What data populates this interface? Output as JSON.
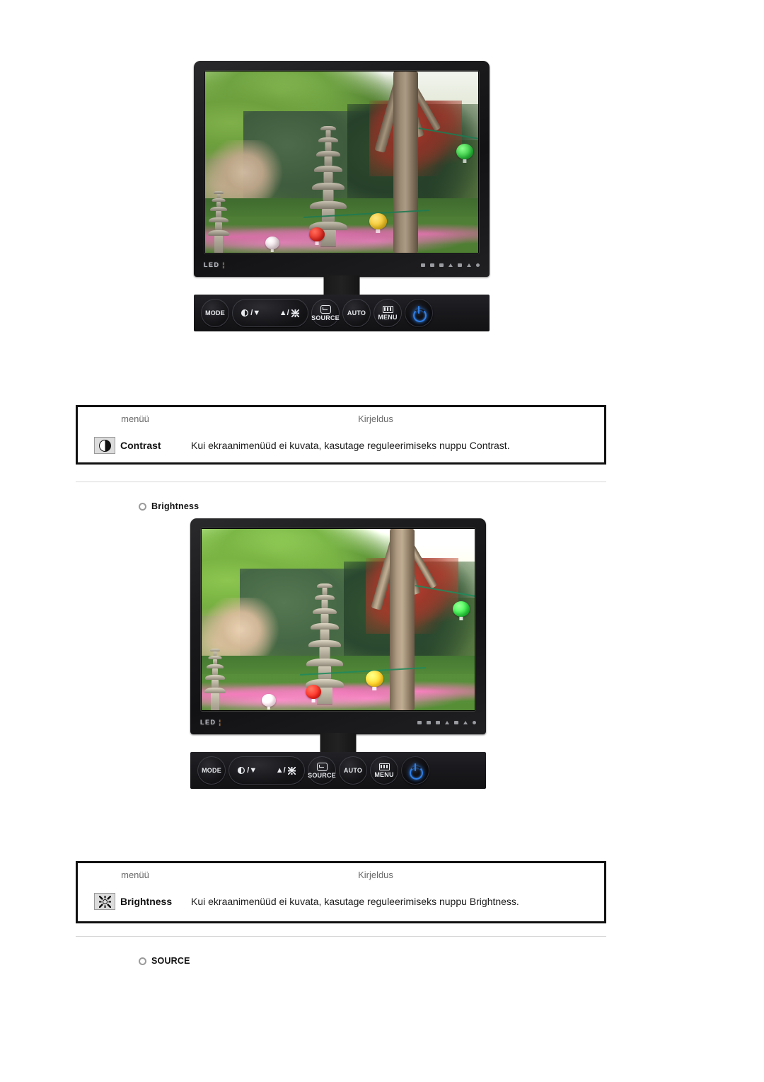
{
  "page": {
    "language": "et",
    "background": "#ffffff"
  },
  "monitors": [
    {
      "id": "monitor-contrast",
      "led_label": "LED",
      "led_indicator": "¦",
      "bezel_icon_names": [
        "minus-icon",
        "pencil-icon",
        "image-icon",
        "triangle-icon",
        "window-icon",
        "triangle-icon",
        "dot-icon"
      ],
      "screen_alt": "Korean garden with stone pagoda, lanterns and trees",
      "buttons": [
        {
          "name": "mode-button",
          "label": "MODE",
          "icon": ""
        },
        {
          "name": "contrast-down-button",
          "label": "/▼",
          "icon": "contrast-icon"
        },
        {
          "name": "brightness-up-button",
          "label": "▲/",
          "icon": "sun-icon"
        },
        {
          "name": "source-button",
          "label": "SOURCE",
          "icon": "source-icon"
        },
        {
          "name": "auto-button",
          "label": "AUTO",
          "icon": ""
        },
        {
          "name": "menu-button",
          "label": "MENU",
          "icon": "menu-icon"
        },
        {
          "name": "power-button",
          "label": "",
          "icon": "power-icon"
        }
      ],
      "power_led_color": "#2f7fe8"
    },
    {
      "id": "monitor-brightness",
      "led_label": "LED",
      "led_indicator": "¦",
      "bezel_icon_names": [
        "minus-icon",
        "pencil-icon",
        "image-icon",
        "triangle-icon",
        "window-icon",
        "triangle-icon",
        "dot-icon"
      ],
      "screen_alt": "Korean garden with stone pagoda, lanterns and trees",
      "buttons": [
        {
          "name": "mode-button",
          "label": "MODE",
          "icon": ""
        },
        {
          "name": "contrast-down-button",
          "label": "/▼",
          "icon": "contrast-icon"
        },
        {
          "name": "brightness-up-button",
          "label": "▲/",
          "icon": "sun-icon"
        },
        {
          "name": "source-button",
          "label": "SOURCE",
          "icon": "source-icon"
        },
        {
          "name": "auto-button",
          "label": "AUTO",
          "icon": ""
        },
        {
          "name": "menu-button",
          "label": "MENU",
          "icon": "menu-icon"
        },
        {
          "name": "power-button",
          "label": "",
          "icon": "power-icon"
        }
      ],
      "power_led_color": "#2f7fe8"
    }
  ],
  "tables": {
    "contrast": {
      "header": {
        "menu": "menüü",
        "description": "Kirjeldus"
      },
      "row": {
        "icon": "contrast-icon",
        "name": "Contrast",
        "description": "Kui ekraanimenüüd ei kuvata, kasutage reguleerimiseks nuppu Contrast."
      }
    },
    "brightness": {
      "header": {
        "menu": "menüü",
        "description": "Kirjeldus"
      },
      "row": {
        "icon": "sun-icon",
        "name": "Brightness",
        "description": "Kui ekraanimenüüd ei kuvata, kasutage reguleerimiseks nuppu Brightness."
      }
    }
  },
  "sections": {
    "brightness_heading": "Brightness",
    "source_heading": "SOURCE"
  },
  "colors": {
    "header_text": "#6a6a6a",
    "body_text": "#1a1a1a",
    "table_border": "#111111",
    "divider": "#d8d8d8",
    "bullet": "#9b9b9b",
    "power_blue": "#2f7fe8"
  }
}
